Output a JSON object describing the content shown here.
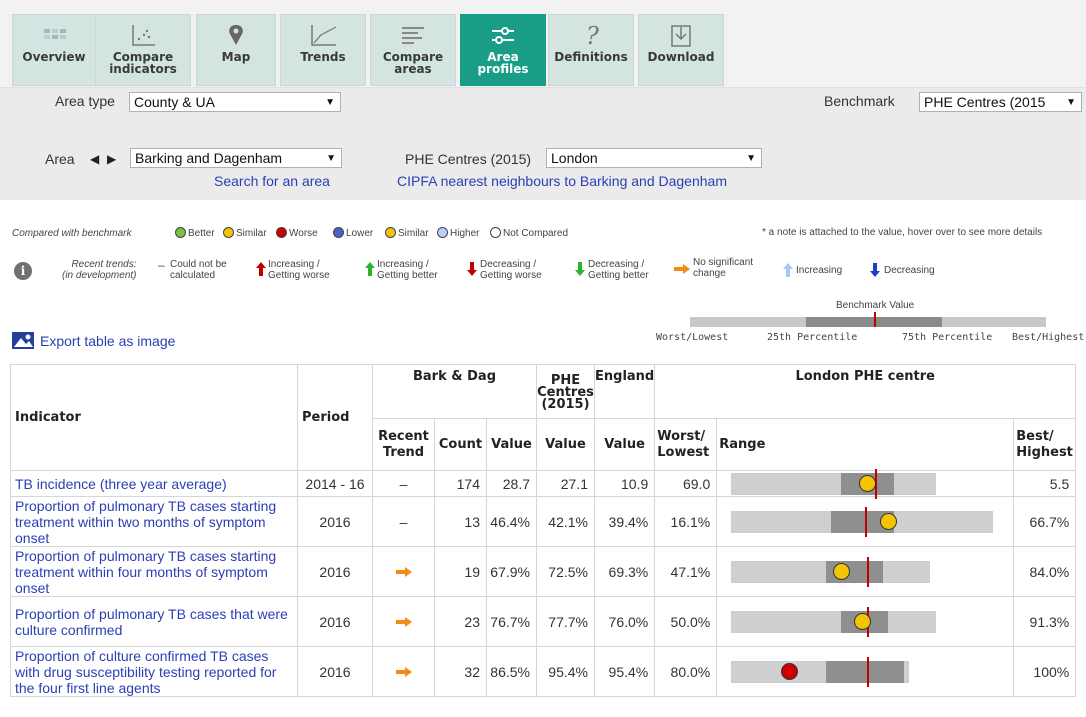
{
  "tabs": [
    {
      "label_line1": "Overview",
      "label_line2": "",
      "icon": "overview-icon",
      "active": false
    },
    {
      "label_line1": "Compare",
      "label_line2": "indicators",
      "icon": "scatter-icon",
      "active": false
    },
    {
      "label_line1": "Map",
      "label_line2": "",
      "icon": "map-pin-icon",
      "active": false
    },
    {
      "label_line1": "Trends",
      "label_line2": "",
      "icon": "trend-line-icon",
      "active": false
    },
    {
      "label_line1": "Compare",
      "label_line2": "areas",
      "icon": "bars-icon",
      "active": false
    },
    {
      "label_line1": "Area",
      "label_line2": "profiles",
      "icon": "sliders-icon",
      "active": true
    },
    {
      "label_line1": "Definitions",
      "label_line2": "",
      "icon": "question-icon",
      "active": false
    },
    {
      "label_line1": "Download",
      "label_line2": "",
      "icon": "download-icon",
      "active": false
    }
  ],
  "selectors": {
    "area_type_label": "Area type",
    "area_type_value": "County & UA",
    "benchmark_label": "Benchmark",
    "benchmark_value": "PHE Centres (2015",
    "area_label": "Area",
    "area_value": "Barking and Dagenham",
    "search_link": "Search for an area",
    "phe_label": "PHE Centres (2015)",
    "phe_value": "London",
    "cipfa_link": "CIPFA nearest neighbours to Barking and Dagenham"
  },
  "legend": {
    "compared_label": "Compared with benchmark",
    "better": "Better",
    "similar": "Similar",
    "worse": "Worse",
    "lower": "Lower",
    "similar2": "Similar",
    "higher": "Higher",
    "not_compared": "Not Compared",
    "note": "* a note is attached to the value, hover over to see more details",
    "recent_trends_1": "Recent trends:",
    "recent_trends_2": "(in development)",
    "cnb_1": "Could not be",
    "cnb_2": "calculated",
    "inc_worse_1": "Increasing /",
    "inc_worse_2": "Getting worse",
    "inc_better_1": "Increasing /",
    "inc_better_2": "Getting better",
    "dec_worse_1": "Decreasing /",
    "dec_worse_2": "Getting worse",
    "dec_better_1": "Decreasing /",
    "dec_better_2": "Getting better",
    "nsc_1": "No significant",
    "nsc_2": "change",
    "increasing": "Increasing",
    "decreasing": "Decreasing",
    "benchmark_value": "Benchmark Value",
    "worst_lowest": "Worst/Lowest",
    "p25": "25th Percentile",
    "p75": "75th Percentile",
    "best_highest": "Best/Highest"
  },
  "export_label": "Export table as image",
  "table": {
    "h_indicator": "Indicator",
    "h_period": "Period",
    "h_area": "Bark & Dag",
    "h_phe_1": "PHE",
    "h_phe_2": "Centres",
    "h_phe_3": "(2015)",
    "h_england": "England",
    "h_region": "London PHE centre",
    "h_recent_1": "Recent",
    "h_recent_2": "Trend",
    "h_count": "Count",
    "h_value": "Value",
    "h_value2": "Value",
    "h_value3": "Value",
    "h_worst_1": "Worst/",
    "h_worst_2": "Lowest",
    "h_range": "Range",
    "h_best_1": "Best/",
    "h_best_2": "Highest",
    "rows": [
      {
        "indicator": "TB incidence (three year average)",
        "period": "2014 - 16",
        "trend": "none",
        "count": "174",
        "value": "28.7",
        "phe": "27.1",
        "england": "10.9",
        "worst": "69.0",
        "best": "5.5",
        "marker_color": "#f5c400",
        "range_lo": 0.0,
        "range_hi": 0.78,
        "mid_lo": 0.42,
        "mid_hi": 0.62,
        "benchmark": 0.55,
        "marker": 0.52
      },
      {
        "indicator": "Proportion of pulmonary TB cases starting treatment within two months of symptom onset",
        "period": "2016",
        "trend": "none",
        "count": "13",
        "value": "46.4%",
        "phe": "42.1%",
        "england": "39.4%",
        "worst": "16.1%",
        "best": "66.7%",
        "marker_color": "#f5c400",
        "range_lo": 0.0,
        "range_hi": 1.0,
        "mid_lo": 0.38,
        "mid_hi": 0.62,
        "benchmark": 0.51,
        "marker": 0.6
      },
      {
        "indicator": "Proportion of pulmonary TB cases starting treatment within four months of symptom onset",
        "period": "2016",
        "trend": "right",
        "count": "19",
        "value": "67.9%",
        "phe": "72.5%",
        "england": "69.3%",
        "worst": "47.1%",
        "best": "84.0%",
        "marker_color": "#f5c400",
        "range_lo": 0.0,
        "range_hi": 0.76,
        "mid_lo": 0.36,
        "mid_hi": 0.58,
        "benchmark": 0.52,
        "marker": 0.42
      },
      {
        "indicator": "Proportion of pulmonary TB cases that were culture confirmed",
        "period": "2016",
        "trend": "right",
        "count": "23",
        "value": "76.7%",
        "phe": "77.7%",
        "england": "76.0%",
        "worst": "50.0%",
        "best": "91.3%",
        "marker_color": "#f5c400",
        "range_lo": 0.0,
        "range_hi": 0.78,
        "mid_lo": 0.42,
        "mid_hi": 0.6,
        "benchmark": 0.52,
        "marker": 0.5
      },
      {
        "indicator": "Proportion of culture confirmed TB cases with drug susceptibility testing reported for the four first line agents",
        "period": "2016",
        "trend": "right",
        "count": "32",
        "value": "86.5%",
        "phe": "95.4%",
        "england": "95.4%",
        "worst": "80.0%",
        "best": "100%",
        "marker_color": "#cc0000",
        "range_lo": 0.0,
        "range_hi": 0.68,
        "mid_lo": 0.36,
        "mid_hi": 0.66,
        "benchmark": 0.52,
        "marker": 0.22
      }
    ]
  }
}
